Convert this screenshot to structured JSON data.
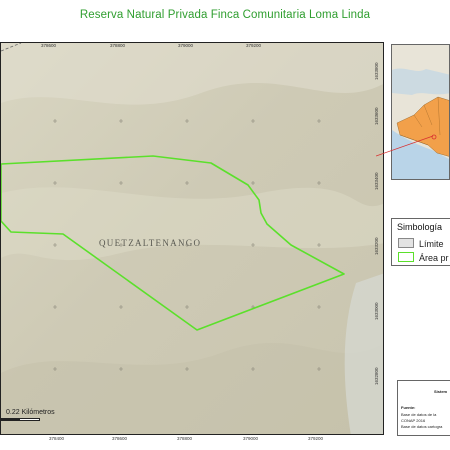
{
  "title": "Reserva Natural Privada Finca Comunitaria Loma Linda",
  "map": {
    "place_label": "QUETZALTENANGO",
    "scale_label": "0.22 Kilómetros",
    "x_ticks_top": [
      "378600",
      "378800",
      "379000",
      "379200"
    ],
    "x_ticks_bottom": [
      "378400",
      "378600",
      "378800",
      "379000",
      "379200"
    ],
    "y_ticks_right": [
      "1633800",
      "1633600",
      "1633400",
      "1633200",
      "1633000",
      "1632800"
    ],
    "colors": {
      "terrain": "#cfcbb6",
      "reserve_outline": "#5be02b",
      "grid_cross": "#8a877a",
      "inset_country": "#f2a04a",
      "inset_ocean": "#b9d4e8",
      "locator_line": "#d83030"
    }
  },
  "legend": {
    "title": "Simbología",
    "items": [
      {
        "label": "Límite",
        "swatch": "gray"
      },
      {
        "label": "Área pr",
        "swatch": "green"
      }
    ]
  },
  "info": {
    "heading": "Sistem",
    "fuente_label": "Fuente:",
    "line1": "Base de datos de la",
    "line2": "CONAP 2016",
    "line3": "Base de datos cartogra"
  }
}
